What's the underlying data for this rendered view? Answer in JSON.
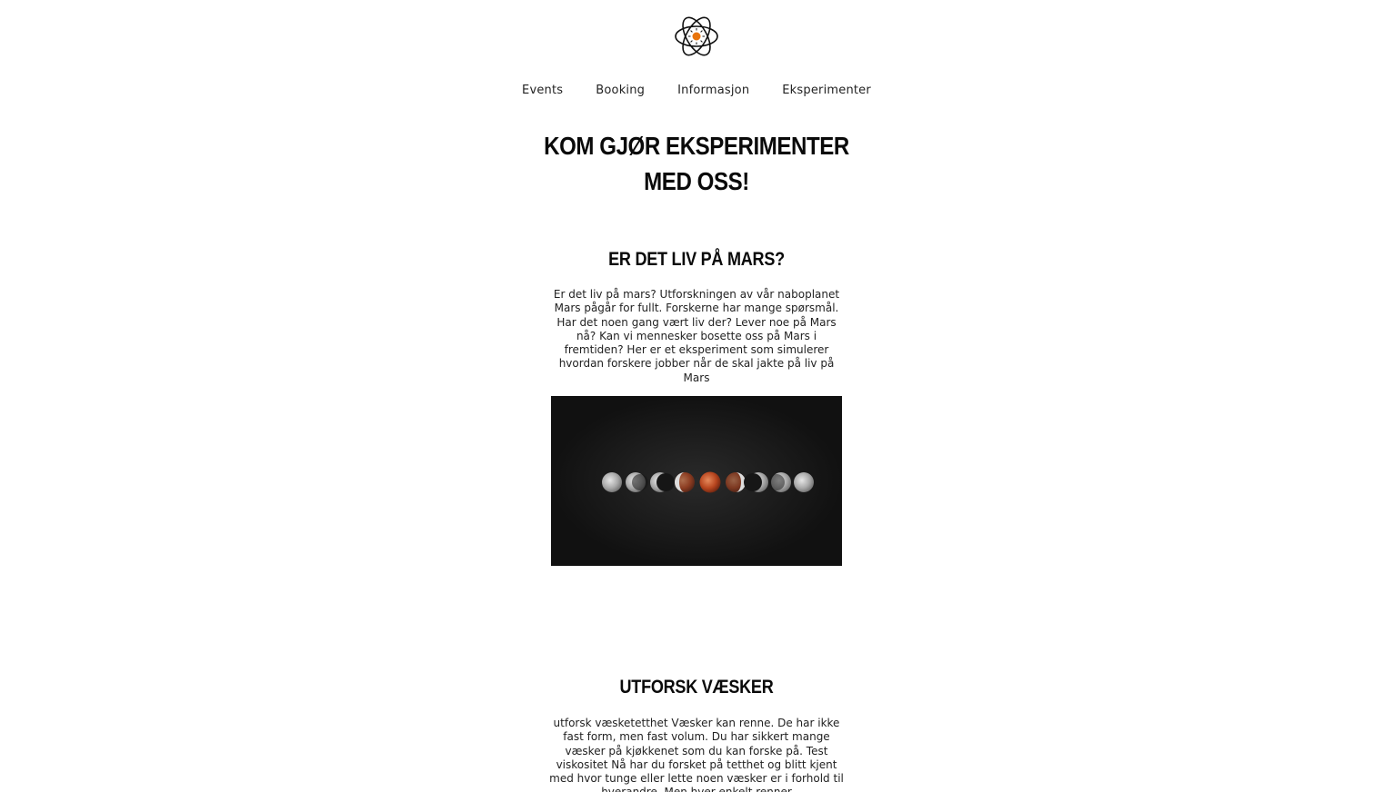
{
  "header": {
    "logo_icon": "atom-icon",
    "accent_color": "#e8740c"
  },
  "nav": {
    "items": [
      {
        "label": "Events"
      },
      {
        "label": "Booking"
      },
      {
        "label": "Informasjon"
      },
      {
        "label": "Eksperimenter"
      }
    ]
  },
  "hero": {
    "title": "KOM GJØR EKSPERIMENTER MED OSS!"
  },
  "experiments": [
    {
      "title": "ER DET LIV PÅ MARS?",
      "text": "Er det liv på mars? Utforskningen av vår naboplanet Mars pågår for fullt. Forskerne har mange spørsmål. Har det noen gang vært liv der? Lever noe på Mars nå? Kan vi mennesker bosette oss på Mars i fremtiden? Her er et eksperiment som simulerer hvordan forskere jobber når de skal jakte på liv på Mars",
      "image": "lunar-eclipse-phases-image"
    },
    {
      "title": "UTFORSK VÆSKER",
      "text": "utforsk væsketetthet Væsker kan renne. De har ikke fast form, men fast volum. Du har sikkert mange væsker på kjøkkenet som du kan forske på. Test viskositet Nå har du forsket på tetthet og blitt kjent med hvor tunge eller lette noen væsker er i forhold til hverandre. Men hver enkelt renner"
    }
  ]
}
